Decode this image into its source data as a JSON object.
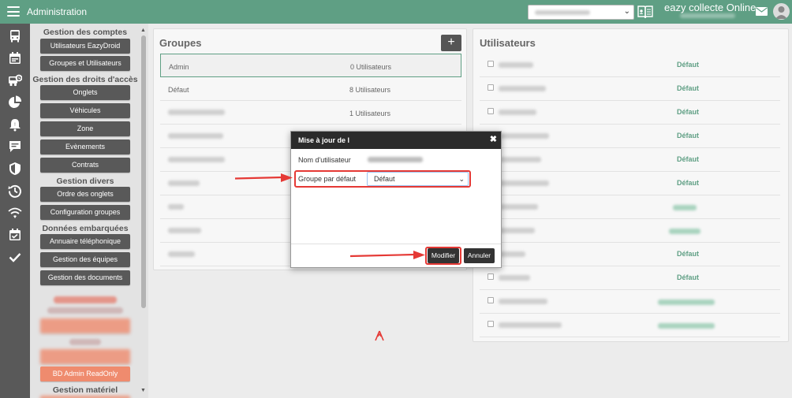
{
  "topbar": {
    "title": "Administration",
    "app_name": "eazy collecte Online",
    "icons": [
      "menu-icon",
      "directory-book-icon",
      "mail-icon",
      "user-avatar-icon"
    ]
  },
  "rail": {
    "icons": [
      "bus-icon",
      "calendar-icon",
      "vehicle-service-icon",
      "pie-chart-icon",
      "alarm-bell-icon",
      "chat-icon",
      "shield-icon",
      "history-icon",
      "wifi-hand-icon",
      "calendar-check-icon",
      "check-icon"
    ]
  },
  "menu": {
    "h_accounts": "Gestion des comptes",
    "b_eazydroid": "Utilisateurs EazyDroid",
    "b_groups_users": "Groupes et Utilisateurs",
    "h_rights": "Gestion des droits d'accès",
    "b_tabs": "Onglets",
    "b_vehicles": "Véhicules",
    "b_zone": "Zone",
    "b_events": "Evènements",
    "b_contracts": "Contrats",
    "h_misc": "Gestion divers",
    "b_tab_order": "Ordre des onglets",
    "b_group_config": "Configuration groupes",
    "h_onboard": "Données embarquées",
    "b_phone_dir": "Annuaire téléphonique",
    "b_teams": "Gestion des équipes",
    "b_documents": "Gestion des documents",
    "b_bd_admin": "BD Admin ReadOnly",
    "h_hardware": "Gestion matériel"
  },
  "groups": {
    "title": "Groupes",
    "add_label": "+",
    "rows": [
      {
        "name": "Admin",
        "count": "0 Utilisateurs"
      },
      {
        "name": "Défaut",
        "count": "8 Utilisateurs"
      },
      {
        "name": "",
        "count": "1 Utilisateurs"
      }
    ]
  },
  "users": {
    "title": "Utilisateurs",
    "default_group": "Défaut"
  },
  "modal": {
    "title": "Mise à jour de l",
    "username_label": "Nom d'utilisateur",
    "group_label": "Groupe par défaut",
    "group_value": "Défaut",
    "modify_label": "Modifier",
    "cancel_label": "Annuler"
  },
  "colors": {
    "accent": "#5f9f84",
    "rail": "#595959",
    "highlight": "#e53935"
  }
}
